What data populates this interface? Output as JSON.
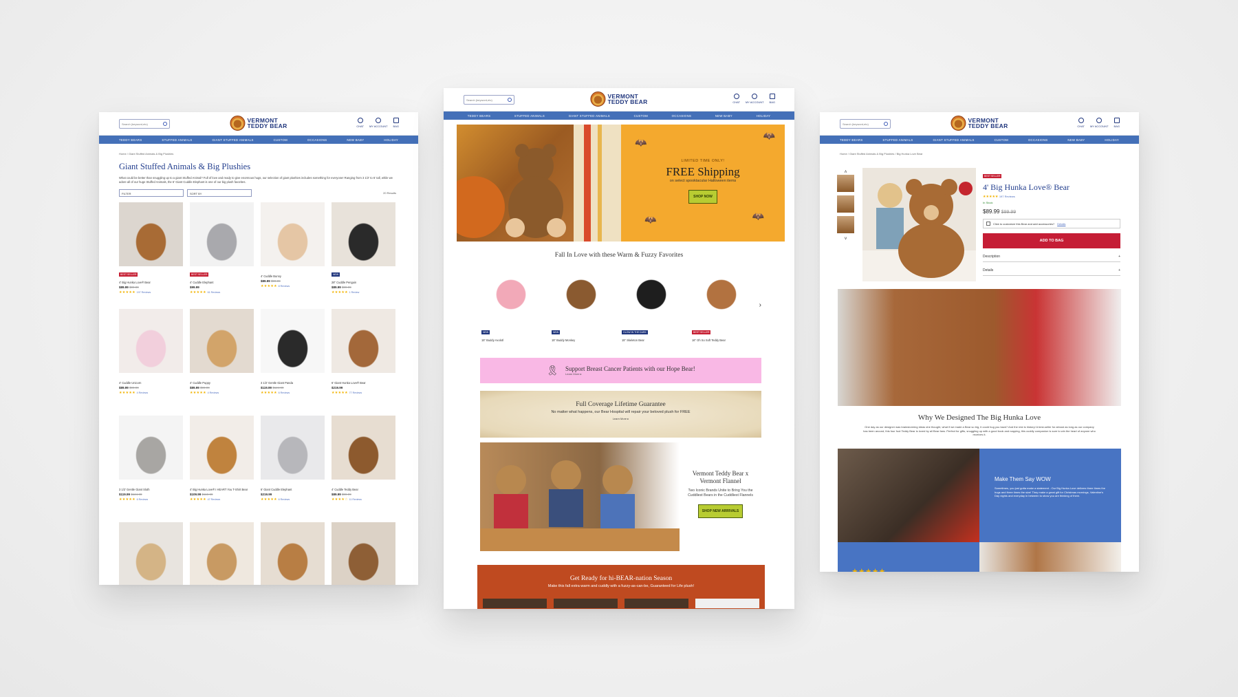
{
  "brand": {
    "logo_line1": "VERMONT",
    "logo_line2": "TEDDY BEAR"
  },
  "header": {
    "search_placeholder": "Search (keyword,etc)",
    "chat": "CHAT",
    "account": "MY ACCOUNT",
    "bag": "BAG"
  },
  "nav": [
    "TEDDY BEARS",
    "STUFFED ANIMALS",
    "GIANT STUFFED ANIMALS",
    "CUSTOM",
    "OCCASIONS",
    "NEW BABY",
    "HOLIDAY"
  ],
  "colors": {
    "nav": "#4470b8",
    "title": "#25408f",
    "best_seller": "#c61f33",
    "new": "#20367d",
    "add_to_bag": "#c51d35",
    "cta_green": "#b8cc32",
    "pink": "#f9b8e5",
    "promo": "#bf4a20",
    "stars": "#f2b300"
  },
  "category_page": {
    "breadcrumb": "Home  /  Giant Stuffed Animals & Big Plushies",
    "title": "Giant Stuffed Animals & Big Plushies",
    "description": "What could be better than snuggling up to a giant Stuffed Animal? Full of love and ready to give enormous hugs, our selection of giant plushies includes something for everyone! Ranging from 3 1/2' to 6' tall, while we adore all of our huge Stuffed Animals, the 6' Giant Cuddle Elephant is one of our big plush favorites.",
    "filter_label": "FILTER",
    "sort_label": "SORT BY",
    "results": "20 Results",
    "products": [
      {
        "badge": "BEST SELLER",
        "name": "4' Big Hunka Love® Bear",
        "price": "$89.99",
        "old_price": "$99.99",
        "stars": "★★★★★",
        "reviews": "197 Reviews",
        "img": [
          "#dcd6cf",
          "#a86b35"
        ]
      },
      {
        "badge": "BEST SELLER",
        "name": "4' Cuddle Elephant",
        "price": "$99.99",
        "old_price": "",
        "stars": "★★★★★",
        "reviews": "61 Reviews",
        "img": [
          "#f2f2f2",
          "#a9a9ad"
        ]
      },
      {
        "badge": "",
        "name": "4' Cuddle Bunny",
        "price": "$89.99",
        "old_price": "$99.99",
        "stars": "★★★★★",
        "reviews": "8 Reviews",
        "img": [
          "#f4f1ee",
          "#e5c6a5"
        ]
      },
      {
        "badge": "NEW",
        "name": "28\" Cuddle Penguin",
        "price": "$89.99",
        "old_price": "$99.99",
        "stars": "★★★★★",
        "reviews": "1 Review",
        "img": [
          "#e8e2da",
          "#2a2a2a"
        ]
      },
      {
        "badge": "",
        "name": "4' Cuddle Unicorn",
        "price": "$89.99",
        "old_price": "$99.99",
        "stars": "★★★★★",
        "reviews": "4 Reviews",
        "img": [
          "#f2ecea",
          "#f2cfdc"
        ]
      },
      {
        "badge": "",
        "name": "4' Cuddle Puppy",
        "price": "$89.99",
        "old_price": "$99.99",
        "stars": "★★★★★",
        "reviews": "4 Reviews",
        "img": [
          "#e3dad0",
          "#d2a46a"
        ]
      },
      {
        "badge": "",
        "name": "3 1/2' Gentle Giant Panda",
        "price": "$119.99",
        "old_price": "$124.99",
        "stars": "★★★★★",
        "reviews": "6 Reviews",
        "img": [
          "#f7f7f7",
          "#2a2a2a"
        ]
      },
      {
        "badge": "",
        "name": "6' Giant Hunka Love® Bear",
        "price": "$219.99",
        "old_price": "",
        "stars": "★★★★★",
        "reviews": "77 Reviews",
        "img": [
          "#efe9e3",
          "#a3683a"
        ]
      },
      {
        "badge": "",
        "name": "3 1/2' Gentle Giant Sloth",
        "price": "$119.99",
        "old_price": "$124.99",
        "stars": "★★★★★",
        "reviews": "6 Reviews",
        "img": [
          "#f4f4f4",
          "#a8a6a3"
        ]
      },
      {
        "badge": "",
        "name": "4' Big Hunka Love® I HEART You T-Shirt Bear",
        "price": "$109.99",
        "old_price": "$119.99",
        "stars": "★★★★★",
        "reviews": "47 Reviews",
        "img": [
          "#f2ede8",
          "#c0833e"
        ]
      },
      {
        "badge": "",
        "name": "6' Giant Cuddle Elephant",
        "price": "$219.99",
        "old_price": "",
        "stars": "★★★★★",
        "reviews": "6 Reviews",
        "img": [
          "#e9e9eb",
          "#b7b7bb"
        ]
      },
      {
        "badge": "",
        "name": "4' Cuddle Teddy Bear",
        "price": "$89.99",
        "old_price": "$99.99",
        "stars": "★★★★☆",
        "reviews": "11 Reviews",
        "img": [
          "#e7ddd1",
          "#8d5a2e"
        ]
      },
      {
        "badge": "",
        "name": "",
        "price": "",
        "old_price": "",
        "stars": "",
        "reviews": "",
        "img": [
          "#e8e4df",
          "#d4b486"
        ]
      },
      {
        "badge": "",
        "name": "",
        "price": "",
        "old_price": "",
        "stars": "",
        "reviews": "",
        "img": [
          "#efe8df",
          "#c89a63"
        ]
      },
      {
        "badge": "",
        "name": "",
        "price": "",
        "old_price": "",
        "stars": "",
        "reviews": "",
        "img": [
          "#e6ddd2",
          "#b87e44"
        ]
      },
      {
        "badge": "",
        "name": "",
        "price": "",
        "old_price": "",
        "stars": "",
        "reviews": "",
        "img": [
          "#dcd2c6",
          "#8e5f36"
        ]
      }
    ]
  },
  "home_page": {
    "hero": {
      "eyebrow": "LIMITED TIME ONLY!",
      "title": "FREE Shipping",
      "subtitle": "on select spooktacular Halloween items",
      "cta": "SHOP NOW"
    },
    "favorites_title": "Fall In Love with these Warm & Fuzzy Favorites",
    "favorites": [
      {
        "badge": "NEW",
        "name": "15\" Buddy Axolotl",
        "img": [
          "#ffffff",
          "#f2a9b8"
        ]
      },
      {
        "badge": "NEW",
        "name": "15\" Buddy Monkey",
        "img": [
          "#ffffff",
          "#8a5a30"
        ]
      },
      {
        "badge": "GLOW IN THE DARK",
        "name": "15\" Skeleton Bear",
        "img": [
          "#ffffff",
          "#1e1e1e"
        ]
      },
      {
        "badge": "BEST SELLER",
        "name": "16\" Oh So Soft Teddy Bear",
        "img": [
          "#ffffff",
          "#b27240"
        ]
      }
    ],
    "pink_banner": {
      "title": "Support Breast Cancer Patients with our Hope Bear!",
      "link": "Learn More ▸"
    },
    "guarantee": {
      "title": "Full Coverage Lifetime Guarantee",
      "subtitle": "No matter what happens, our Bear Hospital will repair your beloved plush for FREE",
      "link": "Learn More ▸"
    },
    "flannel": {
      "title_line1": "Vermont Teddy Bear x",
      "title_line2": "Vermont Flannel",
      "subtitle": "Two Iconic Brands Unite to Bring You the Cuddliest Bears in the Cuddliest Flannels",
      "cta": "SHOP NEW ARRIVALS"
    },
    "hibernation": {
      "title": "Get Ready for hi-BEAR-nation Season",
      "subtitle": "Make this fall extra warm and cuddly with a fuzzy-as-can-be, Guaranteed for Life plush!"
    }
  },
  "product_page": {
    "breadcrumb": "Home  /  Giant Stuffed Animals & Big Plushies  /  Big Hunka Love Bear",
    "badge": "BEST SELLER",
    "name": "4' Big Hunka Love® Bear",
    "stars": "★★★★★",
    "reviews": "197 Reviews",
    "stock": "In Stock",
    "price": "$89.99",
    "old_price": "$99.99",
    "customize": "Click to customize this Bear and add accessories?",
    "details_link": "Details",
    "add_to_bag": "ADD TO BAG",
    "accordion": [
      "Description",
      "Details"
    ],
    "why_title": "Why We Designed The Big Hunka Love",
    "why_text": "One day as our designer was brainstorming ideas she thought, what if we made a Bear so big, it could hug you back? And the rest is history! A best-seller for almost as long as our company has been around, this four foot Teddy Bear is loved by all Bear fans. Perfect for gifts, snuggling up with a good book and napping, this cuddly companion is sure to win the heart of anyone who receives it.",
    "wow_title": "Make Them Say WOW",
    "wow_text": "Sometimes, you just gotta make a statement - Our Big Hunka Love delivers three times the hugs and three times the size! They make a great gift for Christmas mornings, Valentine's Day nights and everyday in between to show you are thinking of them.",
    "bottom_stars": "★★★★★"
  }
}
